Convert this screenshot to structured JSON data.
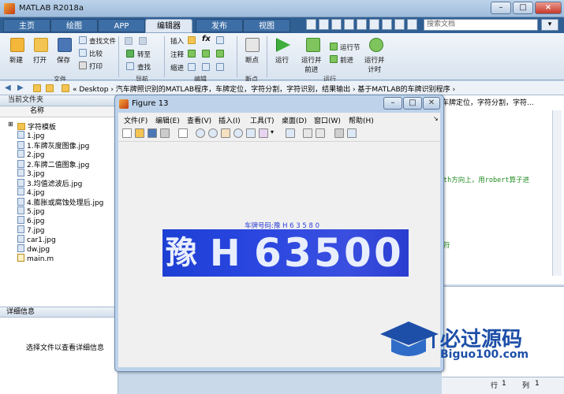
{
  "window": {
    "title": "MATLAB R2018a"
  },
  "tabs": [
    "主页",
    "绘图",
    "APP",
    "编辑器",
    "发布",
    "视图"
  ],
  "search": {
    "placeholder": "搜索文档"
  },
  "ribbon": {
    "file_group": {
      "label": "文件",
      "new": "新建",
      "open": "打开",
      "save": "保存",
      "find_files": "查找文件",
      "compare": "比较",
      "print": "打印"
    },
    "nav_group": {
      "label": "导航",
      "goto": "转至",
      "find": "查找"
    },
    "edit_group": {
      "label": "编辑",
      "insert": "插入",
      "comment": "注释",
      "indent": "缩进",
      "fx": "fx"
    },
    "breakpoint_group": {
      "label": "断点",
      "breakpoints": "断点"
    },
    "run_group": {
      "label": "运行",
      "run": "运行",
      "run_advance": "运行并\n前进",
      "run_section": "运行节",
      "advance": "前进",
      "run_time": "运行并\n计时"
    }
  },
  "address": {
    "path": "«  Desktop  ›  汽车牌照识别的MATLAB程序，车牌定位，字符分割，字符识别，结果输出  ›  基于MATLAB的车牌识别程序  ›",
    "right_overflow": "车牌定位，字符分割，字符..."
  },
  "current_folder": {
    "header": "当前文件夹",
    "column": "名称",
    "items": [
      {
        "name": "字符模板",
        "type": "folder"
      },
      {
        "name": "1.jpg",
        "type": "file"
      },
      {
        "name": "1.车牌灰度图像.jpg",
        "type": "file"
      },
      {
        "name": "2.jpg",
        "type": "file"
      },
      {
        "name": "2.车牌二值图象.jpg",
        "type": "file"
      },
      {
        "name": "3.jpg",
        "type": "file"
      },
      {
        "name": "3.均值滤波后.jpg",
        "type": "file"
      },
      {
        "name": "4.jpg",
        "type": "file"
      },
      {
        "name": "4.膨胀或腐蚀处理后.jpg",
        "type": "file"
      },
      {
        "name": "5.jpg",
        "type": "file"
      },
      {
        "name": "6.jpg",
        "type": "file"
      },
      {
        "name": "7.jpg",
        "type": "file"
      },
      {
        "name": "car1.jpg",
        "type": "file"
      },
      {
        "name": "dw.jpg",
        "type": "file"
      },
      {
        "name": "main.m",
        "type": "file"
      }
    ]
  },
  "details": {
    "header": "详细信息",
    "message": "选择文件以查看详细信息"
  },
  "editor": {
    "line1": "th方向上，用robert算子进",
    "line2": "符"
  },
  "status": {
    "row_label": "行",
    "row_value": "1",
    "col_label": "列",
    "col_value": "1"
  },
  "figure": {
    "title": "Figure 13",
    "menu": [
      "文件(F)",
      "编辑(E)",
      "查看(V)",
      "插入(I)",
      "工具(T)",
      "桌面(D)",
      "窗口(W)",
      "帮助(H)"
    ],
    "caption": "车牌号码:豫 H 6 3 5 8 0",
    "plate_chars": [
      "豫",
      "H",
      "6",
      "3",
      "5",
      "0",
      "0"
    ]
  },
  "watermark": {
    "text": "必过源码",
    "url": "Biguo100.com"
  },
  "colors": {
    "tab_bar": "#2f5f93",
    "accent": "#1d4fa8",
    "plate": "#2b47e0"
  }
}
